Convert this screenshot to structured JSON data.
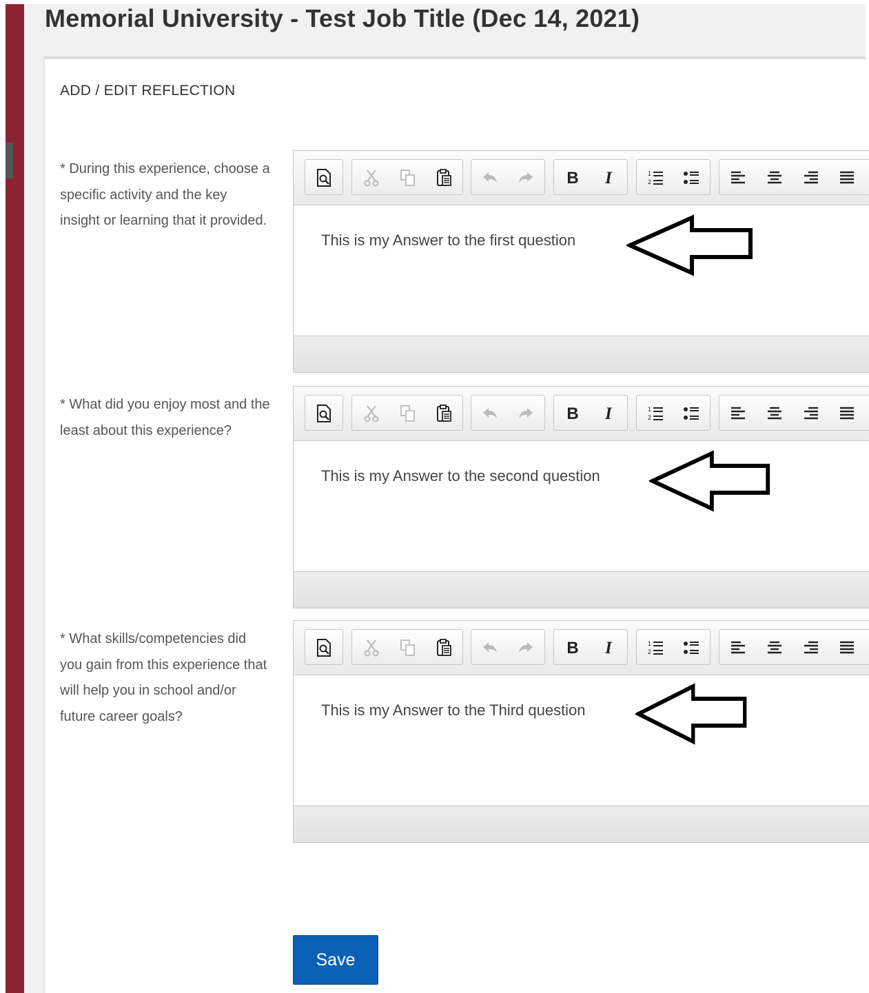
{
  "header": {
    "title": "Memorial University - Test Job Title (Dec 14, 2021)"
  },
  "form": {
    "heading": "ADD / EDIT REFLECTION",
    "questions": [
      {
        "label": "* During this experience, choose a specific activity and the key insight or learning that it provided.",
        "answer": "This is my Answer to the first question"
      },
      {
        "label": "* What did you enjoy most and the least about this experience?",
        "answer": "This is my Answer to the second question"
      },
      {
        "label": "* What skills/competencies did you gain from this experience that will help you in school and/or future career goals?",
        "answer": "This is my Answer to the Third question"
      }
    ],
    "save_label": "Save"
  },
  "toolbar_icons": [
    "preview-icon",
    "cut-icon",
    "copy-icon",
    "paste-icon",
    "undo-icon",
    "redo-icon",
    "bold-icon",
    "italic-icon",
    "numbered-list-icon",
    "bulleted-list-icon",
    "align-left-icon",
    "align-center-icon",
    "align-right-icon",
    "justify-icon"
  ],
  "colors": {
    "accent_bar": "#8b2332",
    "save_button": "#0a61b5"
  }
}
